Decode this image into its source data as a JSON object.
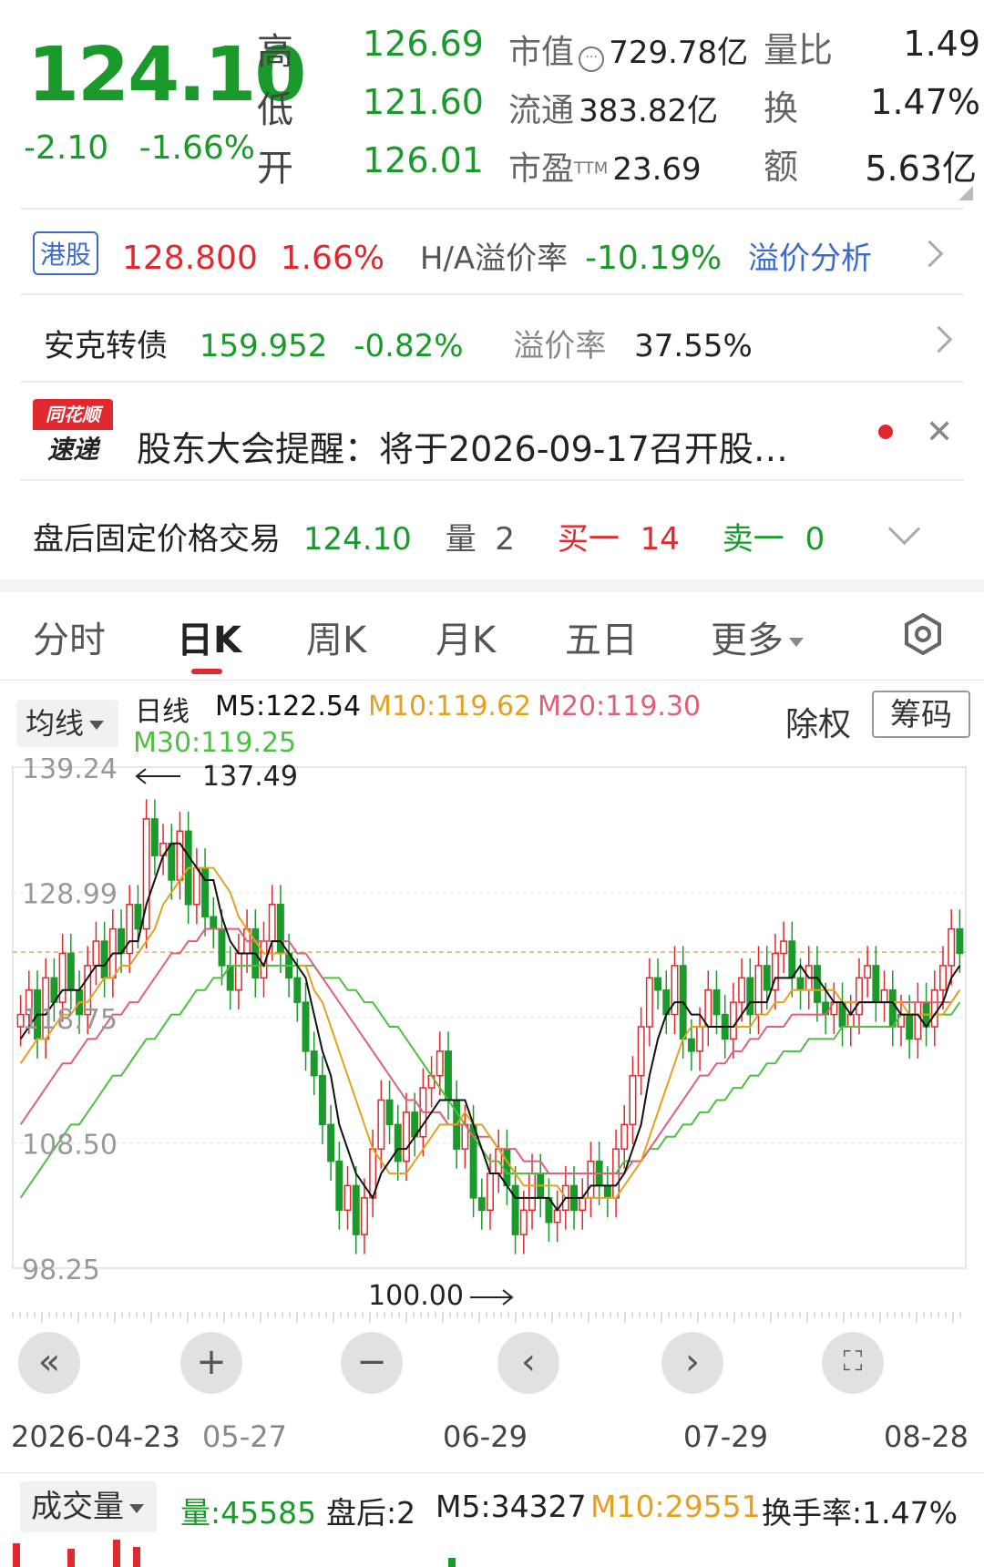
{
  "quote": {
    "price": "124.10",
    "change": "-2.10",
    "change_pct": "-1.66%",
    "high_label": "高",
    "high": "126.69",
    "low_label": "低",
    "low": "121.60",
    "open_label": "开",
    "open": "126.01",
    "mktcap_label": "市值",
    "mktcap": "729.78亿",
    "float_label": "流通",
    "float": "383.82亿",
    "pe_label": "市盈",
    "pe_sup": "TTM",
    "pe": "23.69",
    "volratio_label": "量比",
    "volratio": "1.49",
    "turnover_label": "换",
    "turnover": "1.47%",
    "amount_label": "额",
    "amount": "5.63亿"
  },
  "hk": {
    "badge": "港股",
    "price": "128.800",
    "pct": "1.66%",
    "premium_label": "H/A溢价率",
    "premium": "-10.19%",
    "analysis": "溢价分析"
  },
  "bond": {
    "name": "安克转债",
    "price": "159.952",
    "pct": "-0.82%",
    "premium_label": "溢价率",
    "premium": "37.55%"
  },
  "news": {
    "logo_top": "同花顺",
    "logo_bottom": "速递",
    "text": "股东大会提醒：将于2026-09-17召开股…"
  },
  "afterhours": {
    "label": "盘后固定价格交易",
    "price": "124.10",
    "vol_label": "量",
    "vol": "2",
    "buy_label": "买一",
    "buy": "14",
    "sell_label": "卖一",
    "sell": "0"
  },
  "tabs": [
    "分时",
    "日K",
    "周K",
    "月K",
    "五日",
    "更多"
  ],
  "ma": {
    "button": "均线",
    "period": "日线",
    "m5": "M5:122.54",
    "m10": "M10:119.62",
    "m20": "M20:119.30",
    "m30": "M30:119.25",
    "exright": "除权",
    "chips": "筹码"
  },
  "chart_data": {
    "type": "candlestick",
    "y_ticks": [
      "139.24",
      "128.99",
      "118.75",
      "108.50",
      "98.25"
    ],
    "high_mark": "137.49",
    "low_mark": "100.00",
    "x_labels": [
      "2026-04-23",
      "05-27",
      "06-29",
      "07-29",
      "08-28"
    ],
    "reference_price": 124.1,
    "ylim": [
      98.25,
      139.24
    ],
    "close": [
      119,
      121,
      117,
      122,
      120,
      124,
      121,
      119,
      123,
      125,
      122,
      126,
      124,
      128,
      126,
      135,
      132,
      133,
      130,
      134,
      128,
      131,
      127,
      126,
      123,
      121,
      124,
      126,
      122,
      125,
      128,
      124,
      122,
      120,
      116,
      114,
      110,
      107,
      103,
      105,
      101,
      104,
      108,
      112,
      110,
      107,
      111,
      109,
      113,
      114,
      116,
      112,
      108,
      110,
      104,
      103,
      106,
      108,
      105,
      101,
      103,
      106,
      104,
      102,
      103,
      105,
      103,
      104,
      107,
      105,
      104,
      108,
      110,
      114,
      118,
      122,
      121,
      119,
      123,
      117,
      116,
      118,
      121,
      119,
      117,
      120,
      122,
      119,
      123,
      121,
      124,
      125,
      122,
      121,
      123,
      120,
      119,
      120,
      118,
      119,
      122,
      123,
      120,
      121,
      118,
      119,
      117,
      120,
      118,
      121,
      123,
      126,
      124
    ],
    "ma5": [
      117,
      118,
      119,
      119,
      120,
      121,
      121,
      121,
      122,
      123,
      123,
      124,
      124,
      125,
      125,
      128,
      130,
      132,
      133,
      133,
      132,
      131,
      130,
      130,
      127,
      125,
      124,
      124,
      124,
      123,
      125,
      125,
      124,
      123,
      122,
      119,
      116,
      114,
      110,
      108,
      106,
      105,
      104,
      106,
      107,
      108,
      108,
      109,
      110,
      111,
      112,
      112,
      112,
      112,
      110,
      108,
      106,
      106,
      105,
      104,
      104,
      104,
      104,
      104,
      103,
      104,
      104,
      104,
      105,
      105,
      105,
      105,
      106,
      108,
      110,
      114,
      117,
      119,
      120,
      120,
      119,
      119,
      118,
      118,
      118,
      118,
      119,
      120,
      120,
      120,
      122,
      122,
      122,
      123,
      122,
      122,
      121,
      120,
      120,
      119,
      120,
      120,
      120,
      120,
      120,
      119,
      119,
      119,
      118,
      119,
      120,
      122,
      123
    ],
    "ma10": [
      115,
      116,
      117,
      117,
      118,
      119,
      119,
      120,
      120,
      121,
      122,
      122,
      123,
      123,
      124,
      125,
      126,
      128,
      129,
      130,
      131,
      131,
      131,
      131,
      130,
      129,
      127,
      126,
      125,
      124,
      124,
      124,
      124,
      123,
      123,
      121,
      120,
      118,
      116,
      114,
      112,
      110,
      108,
      107,
      106,
      106,
      106,
      107,
      108,
      109,
      110,
      110,
      110,
      111,
      110,
      110,
      109,
      108,
      107,
      106,
      105,
      105,
      105,
      105,
      105,
      104,
      104,
      104,
      104,
      104,
      104,
      104,
      105,
      106,
      107,
      109,
      111,
      113,
      115,
      117,
      118,
      118,
      118,
      118,
      118,
      118,
      118,
      118,
      119,
      119,
      120,
      120,
      121,
      121,
      121,
      121,
      121,
      121,
      120,
      120,
      120,
      120,
      120,
      120,
      120,
      120,
      119,
      119,
      119,
      119,
      119,
      120,
      121
    ],
    "ma20": [
      110,
      111,
      112,
      113,
      114,
      115,
      115,
      116,
      117,
      117,
      118,
      119,
      119,
      120,
      120,
      121,
      122,
      123,
      124,
      124,
      125,
      125,
      126,
      126,
      126,
      126,
      126,
      125,
      125,
      125,
      125,
      125,
      125,
      124,
      124,
      123,
      122,
      121,
      120,
      119,
      118,
      117,
      116,
      115,
      114,
      113,
      112,
      112,
      111,
      111,
      111,
      110,
      110,
      110,
      109,
      109,
      109,
      108,
      108,
      108,
      107,
      107,
      107,
      106,
      106,
      106,
      106,
      106,
      106,
      106,
      106,
      106,
      106,
      107,
      107,
      108,
      109,
      110,
      111,
      112,
      113,
      114,
      114,
      115,
      115,
      116,
      116,
      117,
      117,
      118,
      118,
      118,
      119,
      119,
      119,
      119,
      119,
      120,
      120,
      120,
      120,
      120,
      120,
      120,
      120,
      120,
      120,
      120,
      120,
      120,
      120,
      120,
      121
    ],
    "ma30": [
      104,
      105,
      106,
      107,
      108,
      109,
      110,
      110,
      111,
      112,
      113,
      114,
      114,
      115,
      116,
      117,
      117,
      118,
      119,
      119,
      120,
      121,
      121,
      122,
      122,
      123,
      123,
      123,
      123,
      123,
      123,
      123,
      123,
      123,
      123,
      123,
      122,
      122,
      122,
      121,
      121,
      120,
      120,
      119,
      118,
      118,
      117,
      116,
      115,
      114,
      113,
      112,
      111,
      110,
      109,
      108,
      107,
      107,
      106,
      106,
      106,
      106,
      106,
      106,
      106,
      106,
      106,
      106,
      106,
      106,
      106,
      106,
      107,
      107,
      107,
      108,
      108,
      109,
      109,
      110,
      110,
      111,
      111,
      112,
      112,
      113,
      113,
      114,
      114,
      115,
      115,
      116,
      116,
      116,
      117,
      117,
      117,
      117,
      118,
      118,
      118,
      118,
      118,
      118,
      118,
      119,
      119,
      119,
      119,
      119,
      119,
      119,
      120
    ]
  },
  "volume_bar": {
    "button": "成交量",
    "vol": "量:45585",
    "after": "盘后:2",
    "m5": "M5:34327",
    "m10": "M10:29551",
    "turnover": "换手率:1.47%"
  },
  "colors": {
    "up": "#e0282e",
    "down": "#1a9a2a",
    "ma5": "#111111",
    "ma10": "#e6a020",
    "ma20": "#e0607a",
    "ma30": "#4cc040"
  }
}
